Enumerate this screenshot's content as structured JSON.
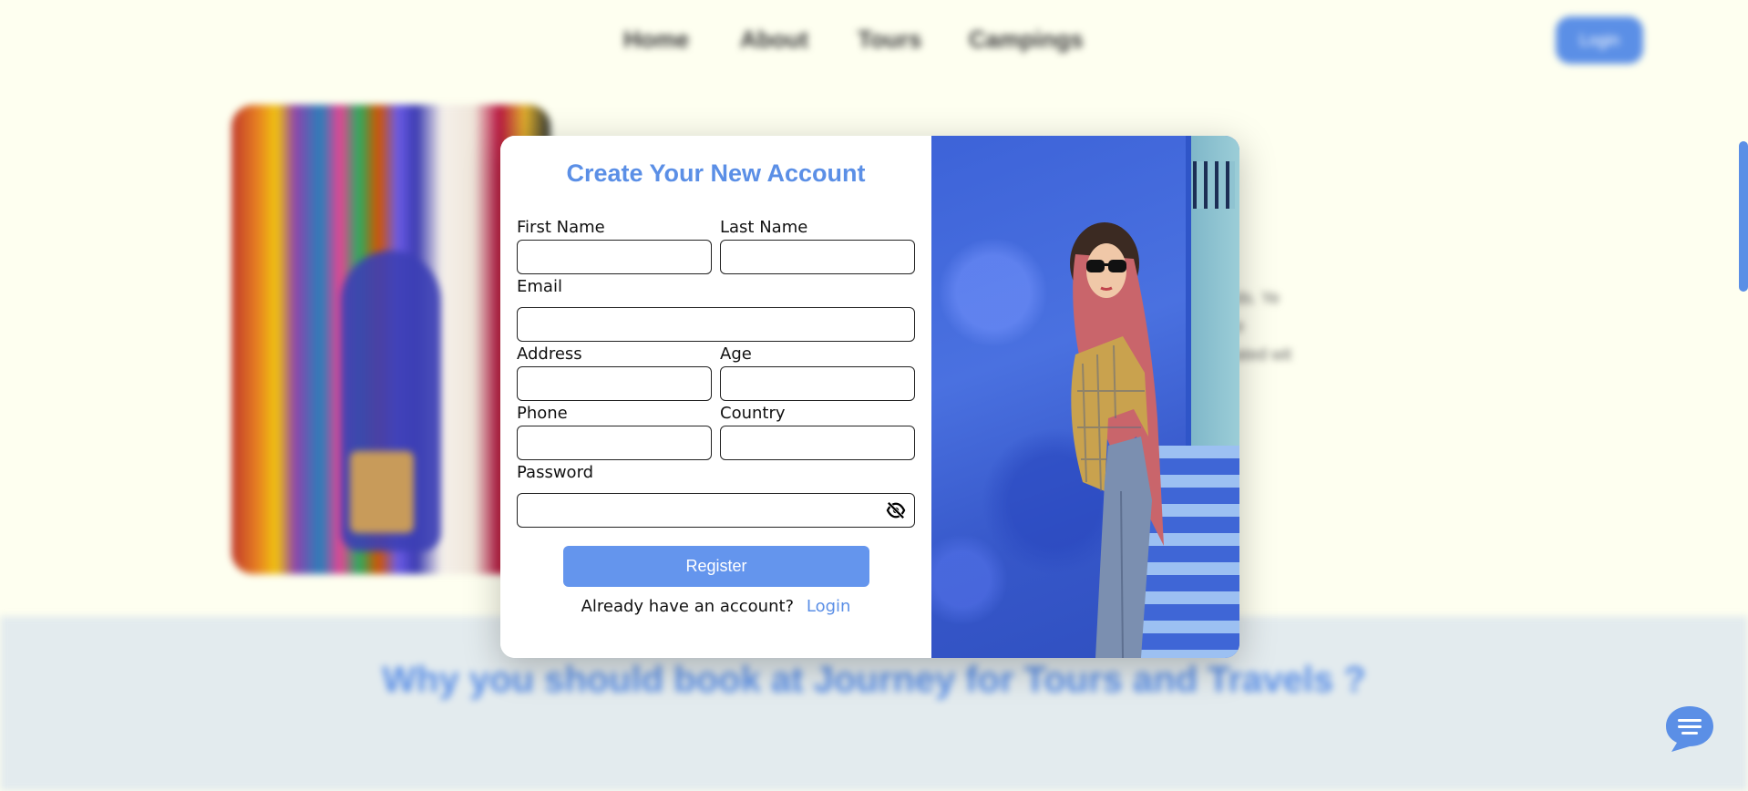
{
  "nav": {
    "items": [
      "Home",
      "About",
      "Tours",
      "Campings"
    ],
    "login_label": "Login"
  },
  "hero": {
    "text_lines": [
      "ds. Ye",
      "e",
      "ated wit"
    ]
  },
  "band": {
    "title": "Why you should book at Journey for Tours and Travels ?"
  },
  "modal": {
    "title": "Create Your New Account",
    "fields": {
      "first_name": {
        "label": "First Name",
        "value": ""
      },
      "last_name": {
        "label": "Last Name",
        "value": ""
      },
      "email": {
        "label": "Email",
        "value": ""
      },
      "address": {
        "label": "Address",
        "value": ""
      },
      "age": {
        "label": "Age",
        "value": ""
      },
      "phone": {
        "label": "Phone",
        "value": ""
      },
      "country": {
        "label": "Country",
        "value": ""
      },
      "password": {
        "label": "Password",
        "value": ""
      }
    },
    "register_label": "Register",
    "login_prompt": "Already have an account?",
    "login_link": "Login"
  },
  "icons": {
    "password_toggle": "eye-slash-icon",
    "chat": "chat-bubble-icon"
  },
  "colors": {
    "accent": "#6495ed",
    "background": "#fefff0",
    "band": "#e3ebee"
  }
}
